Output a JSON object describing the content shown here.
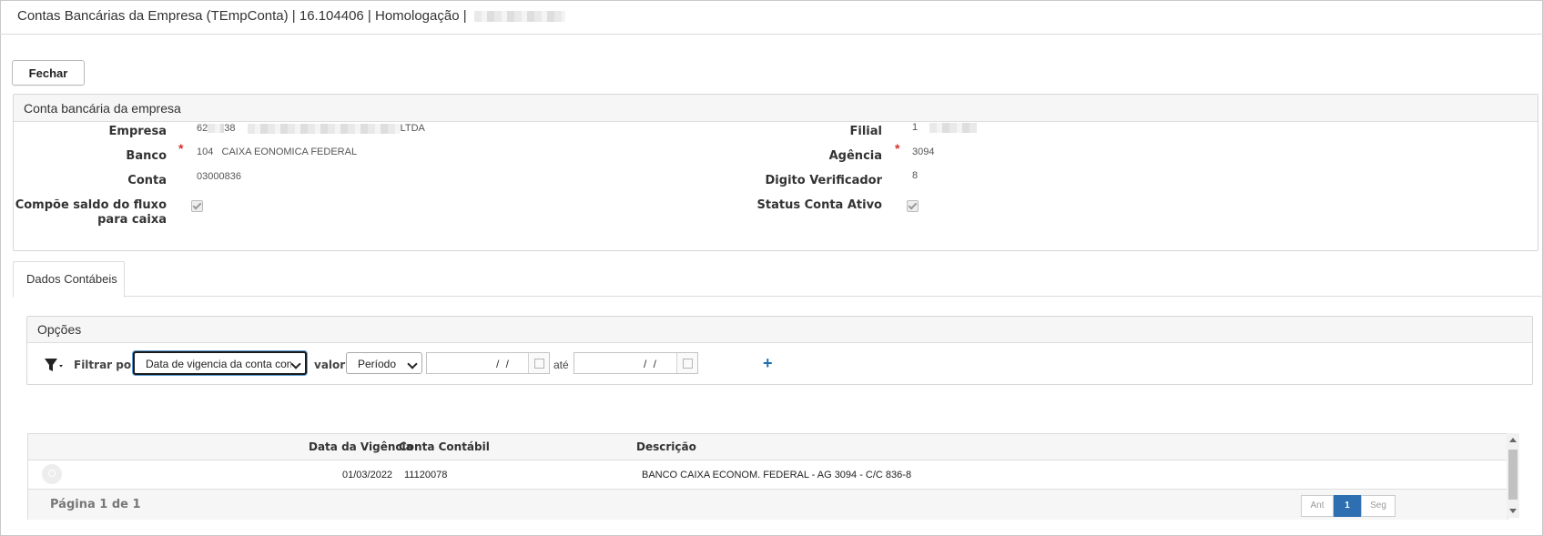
{
  "window": {
    "title": "Contas Bancárias da Empresa (TEmpConta) | 16.104406 | Homologação |"
  },
  "toolbar": {
    "close_label": "Fechar"
  },
  "account_panel": {
    "title": "Conta bancária da empresa",
    "fields": {
      "empresa_label": "Empresa",
      "empresa_code": "62",
      "empresa_code_end": "38",
      "empresa_name_end": "LTDA",
      "filial_label": "Filial",
      "filial_value": "1",
      "banco_label": "Banco",
      "banco_code": "104",
      "banco_name": "CAIXA EONOMICA FEDERAL",
      "agencia_label": "Agência",
      "agencia_value": "3094",
      "conta_label": "Conta",
      "conta_value": "03000836",
      "digito_label": "Digito Verificador",
      "digito_value": "8",
      "compoe_label_line1": "Compõe saldo do fluxo",
      "compoe_label_line2": "para caixa",
      "status_label": "Status Conta Ativo",
      "required_mark": "*"
    }
  },
  "tabs": [
    {
      "label": "Dados Contábeis"
    }
  ],
  "options": {
    "title": "Opções",
    "filter_icon": "filter-icon",
    "filter_by_label": "Filtrar por",
    "filter_field_selected": "Data de vigencia da conta cont",
    "value_label": "valor",
    "value_mode_selected": "Período",
    "date_from_placeholder": "/ /",
    "until_label": "até",
    "date_to_placeholder": "/ /",
    "add_label": "+"
  },
  "grid": {
    "columns": [
      "Data da Vigência",
      "Conta Contábil",
      "Descrição"
    ],
    "rows": [
      {
        "data_vigencia": "01/03/2022",
        "conta_contabil": "11120078",
        "descricao": "BANCO CAIXA ECONOM. FEDERAL - AG 3094 - C/C 836-8"
      }
    ],
    "page_info": "Página 1 de 1",
    "pager": {
      "prev": "Ant",
      "current": "1",
      "next": "Seg"
    }
  }
}
